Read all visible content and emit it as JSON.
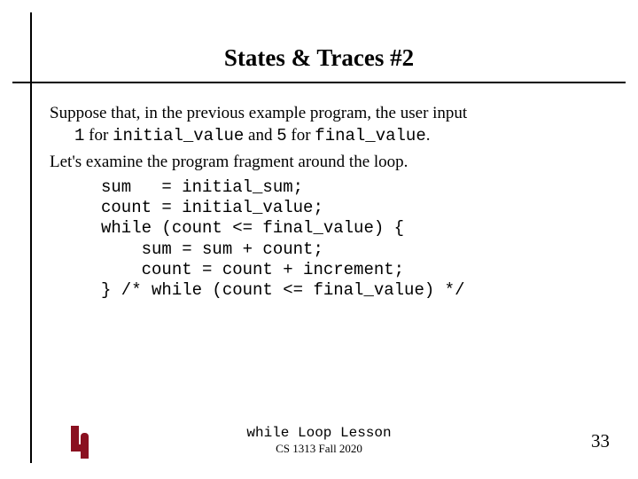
{
  "title": "States & Traces #2",
  "para1_a": "Suppose that, in the previous example program, the user input",
  "para1_b_pre": "1",
  "para1_b_mid1": " for ",
  "para1_b_code1": "initial_value",
  "para1_b_mid2": " and ",
  "para1_b_code2pre": "5",
  "para1_b_mid3": " for ",
  "para1_b_code2": "final_value",
  "para1_b_end": ".",
  "para2": "Let's examine the program fragment around the loop.",
  "code": "sum   = initial_sum;\ncount = initial_value;\nwhile (count <= final_value) {\n    sum = sum + count;\n    count = count + increment;\n} /* while (count <= final_value) */",
  "footer": {
    "lesson": "while Loop Lesson",
    "course": "CS 1313 Fall 2020"
  },
  "page_number": "33",
  "logo_color": "#8a1020"
}
